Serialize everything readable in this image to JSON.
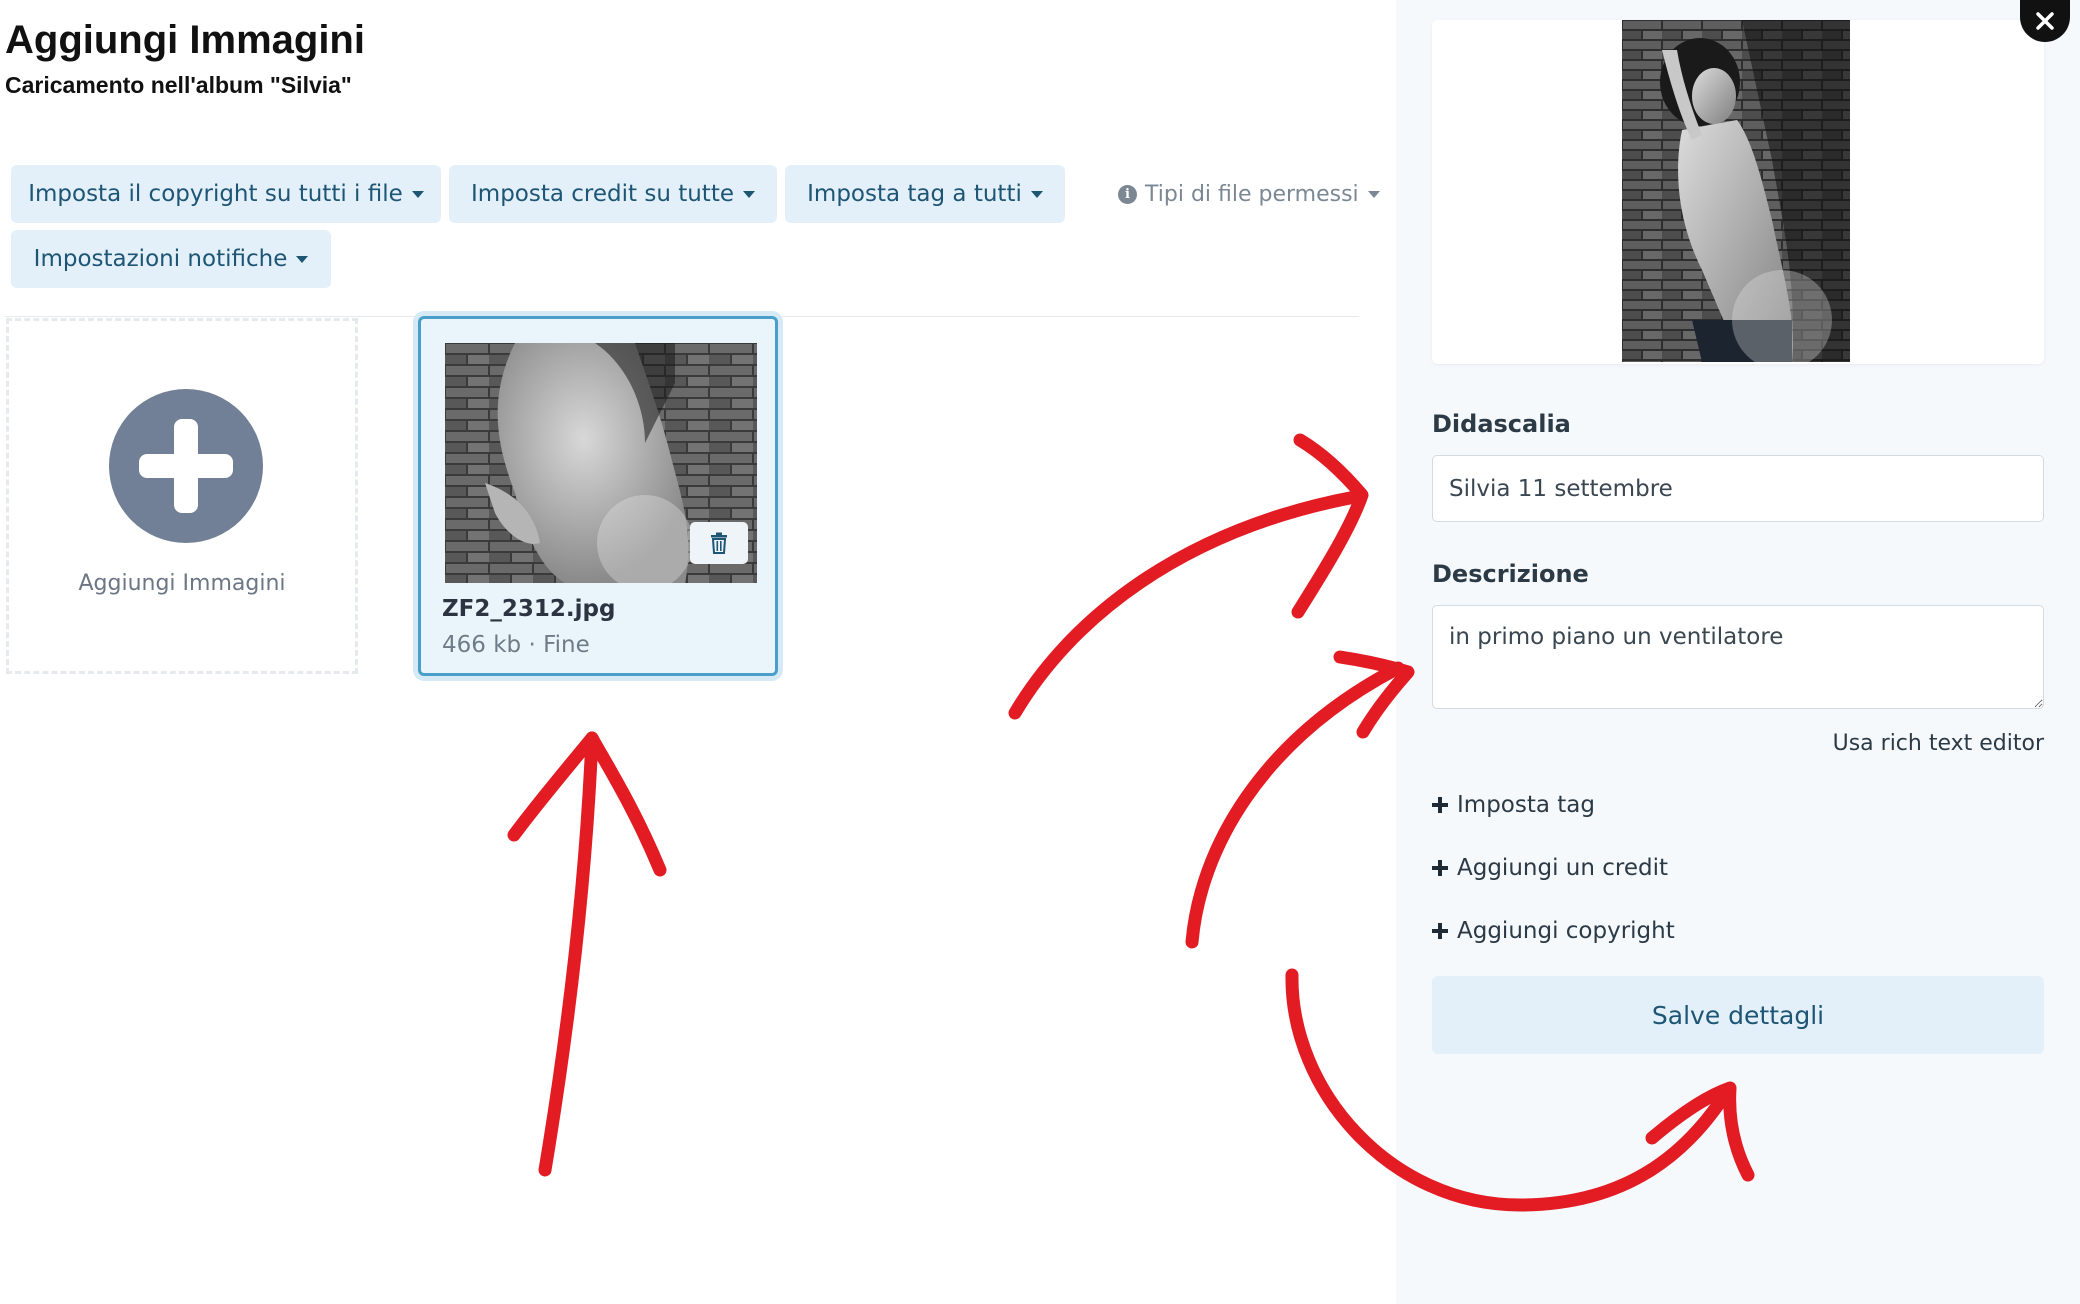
{
  "header": {
    "title": "Aggiungi Immagini",
    "subtitle": "Caricamento nell'album \"Silvia\""
  },
  "toolbar": {
    "copyright_label": "Imposta il copyright su tutti i file",
    "credit_label": "Imposta credit su tutte",
    "tag_label": "Imposta tag a tutti",
    "notifications_label": "Impostazioni notifiche",
    "file_types_label": "Tipi di file permessi",
    "file_types_icon": "info-circle-icon"
  },
  "upload": {
    "add_label": "Aggiungi Immagini",
    "add_icon": "plus-circle-icon"
  },
  "files": [
    {
      "name": "ZF2_2312.jpg",
      "meta": "466 kb · Fine",
      "delete_icon": "trash-icon"
    }
  ],
  "details": {
    "caption_label": "Didascalia",
    "caption_value": "Silvia 11 settembre",
    "description_label": "Descrizione",
    "description_value": "in primo piano un ventilatore",
    "rich_text_label": "Usa rich text editor",
    "actions": [
      "Imposta tag",
      "Aggiungi un credit",
      "Aggiungi copyright"
    ],
    "save_label": "Salve dettagli",
    "close_icon": "close-icon"
  },
  "colors": {
    "accent_bg": "#e4f0f9",
    "accent_text": "#1d5574",
    "selected_border": "#4a9ecb",
    "annotation_red": "#e31b23",
    "panel_bg": "#f5f9fc"
  }
}
